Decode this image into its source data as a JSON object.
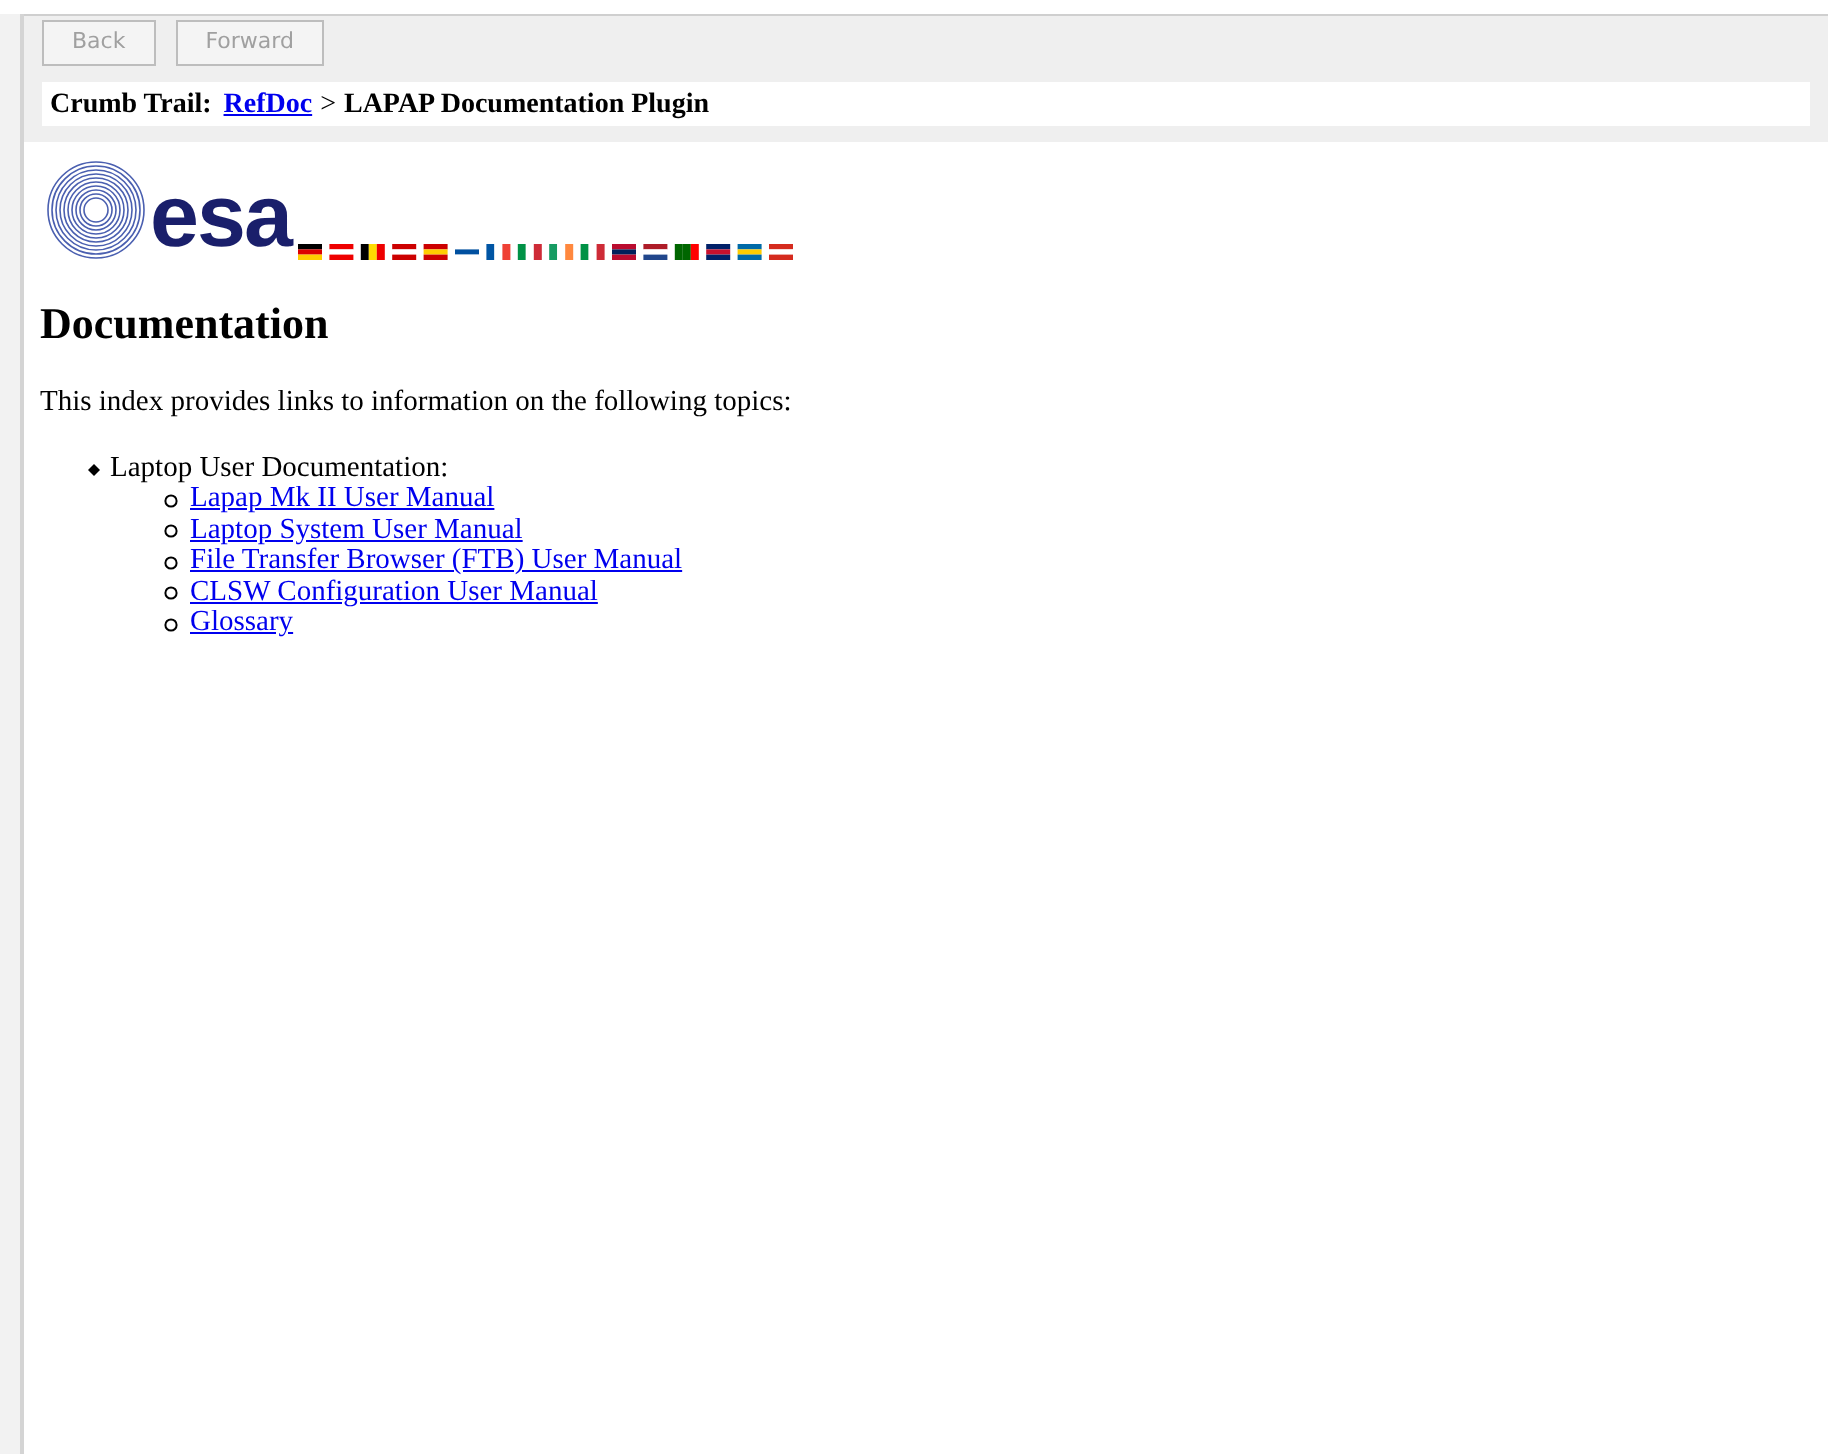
{
  "toolbar": {
    "buttons": [
      {
        "label": "Back",
        "disabled": true
      },
      {
        "label": "Forward",
        "disabled": true
      }
    ]
  },
  "crumb_trail": {
    "label": "Crumb Trail:",
    "links": [
      {
        "label": "RefDoc"
      }
    ],
    "separator": ">",
    "current": "LAPAP Documentation Plugin"
  },
  "logo": {
    "text": "esa"
  },
  "heading": "Documentation",
  "intro": "This index provides links to information on the following topics:",
  "topics": [
    {
      "label": "Laptop User Documentation:",
      "children": [
        {
          "label": "Lapap Mk II User Manual"
        },
        {
          "label": "Laptop System User Manual"
        },
        {
          "label": "File Transfer Browser (FTB) User Manual"
        },
        {
          "label": "CLSW Configuration User Manual"
        },
        {
          "label": "Glossary"
        }
      ]
    }
  ]
}
